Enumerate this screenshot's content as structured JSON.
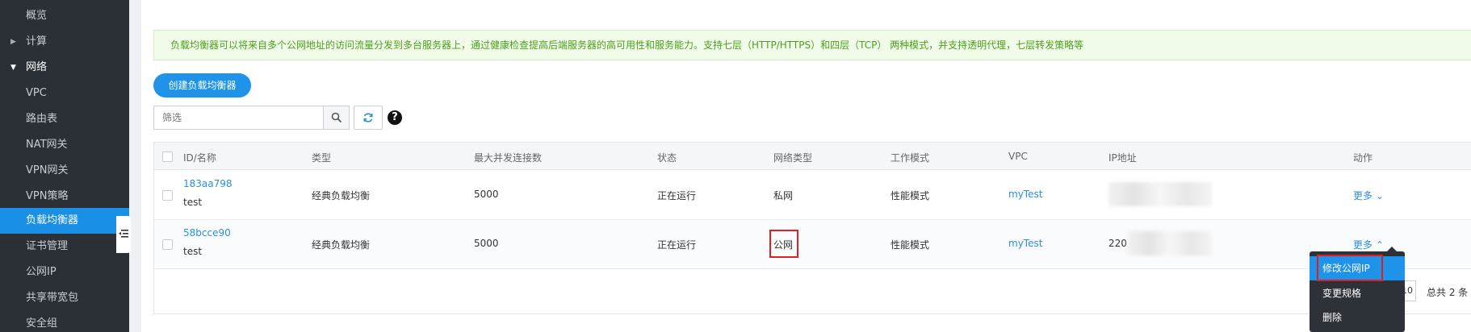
{
  "sidebar": {
    "items": [
      {
        "label": "概览"
      },
      {
        "label": "计算",
        "arrow": "▶"
      },
      {
        "label": "网络",
        "arrow": "▼"
      },
      {
        "label": "VPC"
      },
      {
        "label": "路由表"
      },
      {
        "label": "NAT网关"
      },
      {
        "label": "VPN网关"
      },
      {
        "label": "VPN策略"
      },
      {
        "label": "负载均衡器"
      },
      {
        "label": "证书管理"
      },
      {
        "label": "公网IP"
      },
      {
        "label": "共享带宽包"
      },
      {
        "label": "安全组"
      }
    ]
  },
  "notice": "负载均衡器可以将来自多个公网地址的访问流量分发到多台服务器上，通过健康检查提高后端服务器的高可用性和服务能力。支持七层（HTTP/HTTPS）和四层（TCP） 两种模式，并支持透明代理，七层转发策略等",
  "toolbar": {
    "create_label": "创建负载均衡器",
    "search_placeholder": "筛选",
    "help_label": "?"
  },
  "table": {
    "headers": [
      "ID/名称",
      "类型",
      "最大并发连接数",
      "状态",
      "网络类型",
      "工作模式",
      "VPC",
      "IP地址",
      "动作"
    ],
    "rows": [
      {
        "id": "183aa798",
        "name": "test",
        "type": "经典负载均衡",
        "max_conn": "5000",
        "status": "正在运行",
        "net_type": "私网",
        "mode": "性能模式",
        "vpc": "myTest",
        "ip": "",
        "action": "更多 ⌄"
      },
      {
        "id": "58bcce90",
        "name": "test",
        "type": "经典负载均衡",
        "max_conn": "5000",
        "status": "正在运行",
        "net_type": "公网",
        "mode": "性能模式",
        "vpc": "myTest",
        "ip": "220",
        "action": "更多 ⌃"
      }
    ]
  },
  "menu": {
    "items": [
      "修改公网IP",
      "变更规格",
      "删除"
    ]
  },
  "pager": {
    "page_size": "10",
    "total": "总共 2 条"
  },
  "colors": {
    "sidebar_bg": "#2b2f36",
    "accent": "#1f93ea",
    "notice_text": "#4aa11b",
    "highlight_border": "#e02020"
  }
}
